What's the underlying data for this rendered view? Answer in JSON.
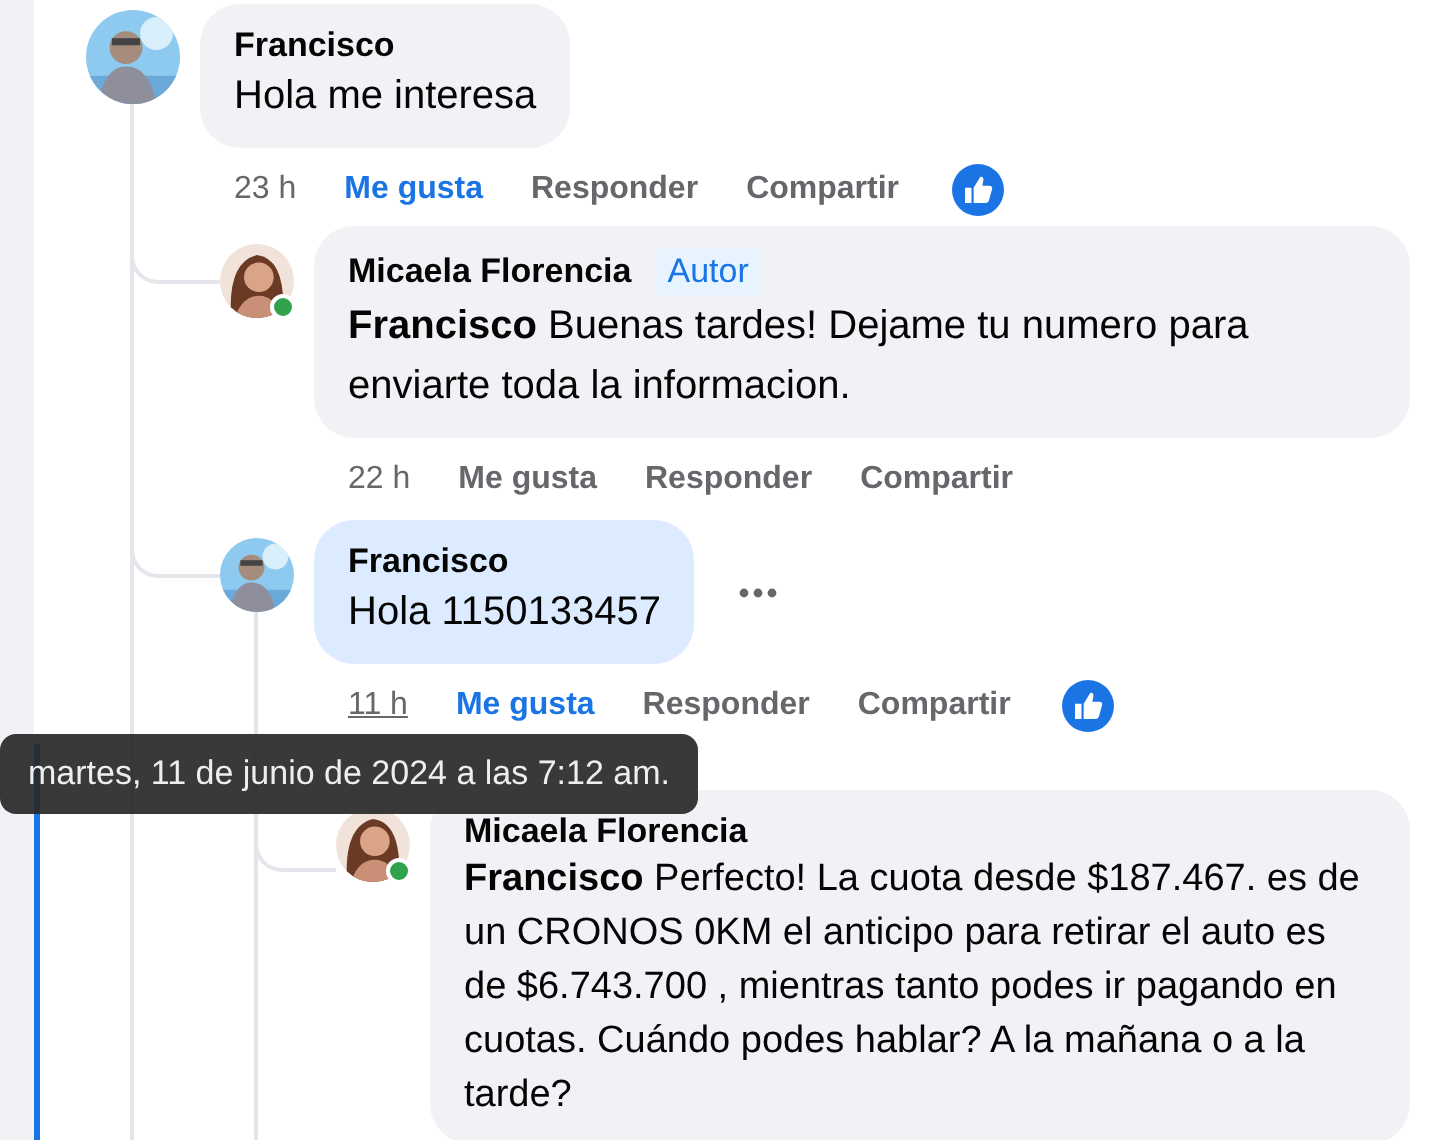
{
  "comments": [
    {
      "author": "Francisco",
      "online": false,
      "text": "Hola me interesa",
      "highlighted": false,
      "time": "23 h",
      "time_hovered": false,
      "liked": true,
      "actions": [
        "Me gusta",
        "Responder",
        "Compartir"
      ],
      "reaction": true,
      "more_menu": false,
      "children": [
        {
          "author": "Micaela Florencia",
          "author_badge": "Autor",
          "online": true,
          "text": "**Francisco** Buenas tardes! Dejame tu numero para enviarte toda la informacion.",
          "highlighted": false,
          "time": "22 h",
          "time_hovered": false,
          "liked": false,
          "actions": [
            "Me gusta",
            "Responder",
            "Compartir"
          ],
          "reaction": false,
          "more_menu": false
        },
        {
          "author": "Francisco",
          "online": false,
          "text": "Hola 1150133457",
          "highlighted": true,
          "time": "11 h",
          "time_hovered": true,
          "liked": true,
          "actions": [
            "Me gusta",
            "Responder",
            "Compartir"
          ],
          "reaction": true,
          "more_menu": true,
          "children": [
            {
              "author": "Micaela Florencia",
              "online": true,
              "text": "**Francisco** Perfecto! La cuota desde $187.467. es de un CRONOS 0KM el anticipo para retirar el auto es de $6.743.700 , mientras tanto podes ir pagando en cuotas. Cuándo podes hablar? A la mañana o a la tarde?",
              "highlighted": false
            }
          ]
        }
      ]
    }
  ],
  "tooltip": {
    "text": "martes, 11 de junio de 2024 a las 7:12 am."
  },
  "focus_bar": true
}
